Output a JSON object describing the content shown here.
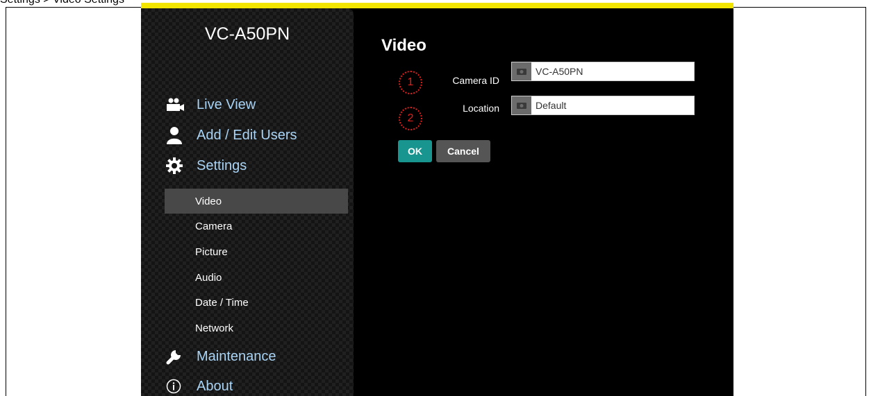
{
  "doc": {
    "top_text": "Settings > Video Settings"
  },
  "app": {
    "model_name": "VC-A50PN",
    "nav": {
      "live_view": "Live View",
      "add_edit_users": "Add / Edit Users",
      "settings": "Settings",
      "maintenance": "Maintenance",
      "about": "About"
    },
    "settings_sub": [
      "Video",
      "Camera",
      "Picture",
      "Audio",
      "Date / Time",
      "Network"
    ],
    "content": {
      "title": "Video",
      "camera_id_label": "Camera ID",
      "camera_id_value": "VC-A50PN",
      "location_label": "Location",
      "location_value": "Default",
      "ok_label": "OK",
      "cancel_label": "Cancel"
    },
    "badges": [
      "1",
      "2"
    ],
    "colors": {
      "nav_text": "#a9d4f6",
      "ok_button": "#18958f",
      "badge": "#e0201c",
      "top_strip": "#f2e500"
    }
  }
}
